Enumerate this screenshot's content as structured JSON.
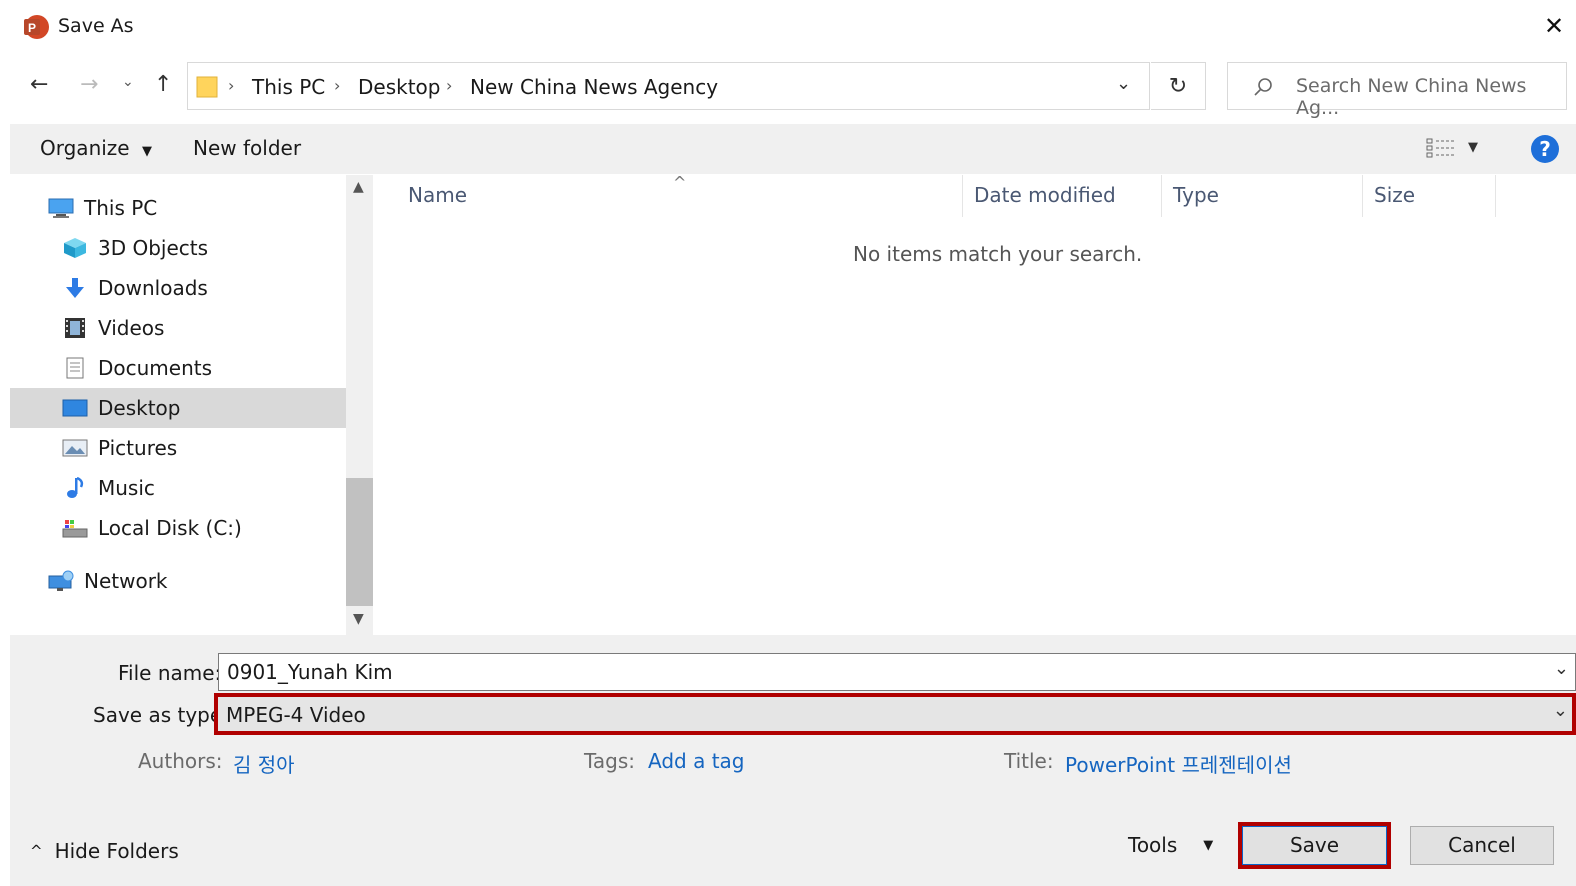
{
  "window": {
    "title": "Save As",
    "app_icon_letter": "P"
  },
  "nav": {
    "breadcrumb": [
      "This PC",
      "Desktop",
      "New China News Agency"
    ],
    "search_placeholder": "Search New China News Ag..."
  },
  "toolbar": {
    "organize_label": "Organize",
    "new_folder_label": "New folder",
    "help_label": "?"
  },
  "sidebar": {
    "this_pc": "This PC",
    "items": [
      "3D Objects",
      "Downloads",
      "Videos",
      "Documents",
      "Desktop",
      "Pictures",
      "Music",
      "Local Disk (C:)"
    ],
    "selected": "Desktop",
    "network": "Network"
  },
  "columns": [
    "Name",
    "Date modified",
    "Type",
    "Size"
  ],
  "empty_message": "No items match your search.",
  "form": {
    "file_name_label": "File name:",
    "file_name_value": "0901_Yunah Kim",
    "save_type_label": "Save as type:",
    "save_type_value": "MPEG-4 Video",
    "authors_label": "Authors:",
    "authors_value": "김 정아",
    "tags_label": "Tags:",
    "tags_value": "Add a tag",
    "title_label": "Title:",
    "title_value": "PowerPoint 프레젠테이션"
  },
  "footer": {
    "hide_folders": "Hide Folders",
    "tools": "Tools",
    "save": "Save",
    "cancel": "Cancel"
  },
  "colors": {
    "highlight_frame": "#b00000",
    "link_blue": "#1565c0",
    "ppt_orange": "#d24726"
  }
}
